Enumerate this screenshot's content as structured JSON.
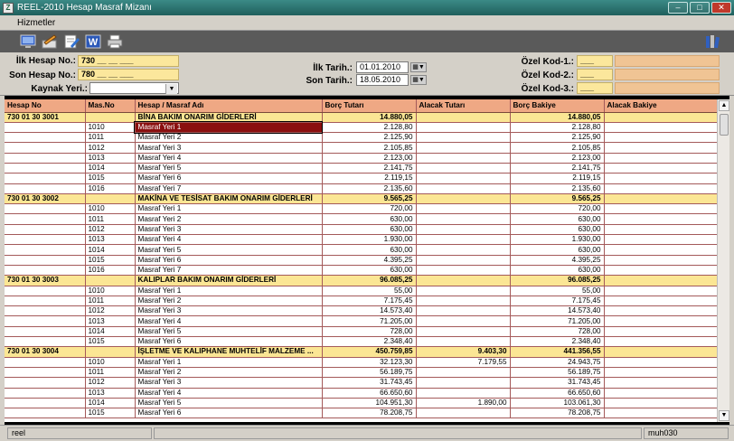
{
  "window": {
    "title": "REEL-2010 Hesap Masraf Mizanı",
    "app_icon": "Z"
  },
  "menu": {
    "items": [
      "Hizmetler"
    ]
  },
  "toolbar": {
    "icons": [
      "monitor-icon",
      "edit-icon",
      "edit-doc-icon",
      "word-icon",
      "printer-icon",
      "books-icon"
    ]
  },
  "form": {
    "ilk_hesap_label": "İlk Hesap No.:",
    "ilk_hesap_value": "730 __ __ ___",
    "son_hesap_label": "Son Hesap No.:",
    "son_hesap_value": "780 __ __ ___",
    "kaynak_label": "Kaynak Yeri.:",
    "kaynak_value": "",
    "ilk_tarih_label": "İlk Tarih.:",
    "ilk_tarih_value": "01.01.2010",
    "son_tarih_label": "Son Tarih.:",
    "son_tarih_value": "18.05.2010",
    "ozel1_label": "Özel Kod-1.:",
    "ozel2_label": "Özel Kod-2.:",
    "ozel3_label": "Özel Kod-3.:",
    "ozel1_value": "___",
    "ozel2_value": "___",
    "ozel3_value": "___"
  },
  "grid": {
    "columns": [
      "Hesap No",
      "Mas.No",
      "Hesap / Masraf Adı",
      "Borç Tutarı",
      "Alacak Tutarı",
      "Borç Bakiye",
      "Alacak Bakiye"
    ],
    "rows": [
      {
        "type": "grp",
        "hesap": "730 01 30 3001",
        "mas": "",
        "ad": "BİNA BAKIM ONARIM GİDERLERİ",
        "borc": "14.880,05",
        "alacak": "",
        "bb": "14.880,05",
        "ab": ""
      },
      {
        "type": "row",
        "hesap": "",
        "mas": "1010",
        "ad": "Masraf Yeri 1",
        "borc": "2.128,80",
        "alacak": "",
        "bb": "2.128,80",
        "ab": "",
        "selected": true
      },
      {
        "type": "row",
        "hesap": "",
        "mas": "1011",
        "ad": "Masraf Yeri 2",
        "borc": "2.125,90",
        "alacak": "",
        "bb": "2.125,90",
        "ab": ""
      },
      {
        "type": "row",
        "hesap": "",
        "mas": "1012",
        "ad": "Masraf Yeri 3",
        "borc": "2.105,85",
        "alacak": "",
        "bb": "2.105,85",
        "ab": ""
      },
      {
        "type": "row",
        "hesap": "",
        "mas": "1013",
        "ad": "Masraf Yeri 4",
        "borc": "2.123,00",
        "alacak": "",
        "bb": "2.123,00",
        "ab": ""
      },
      {
        "type": "row",
        "hesap": "",
        "mas": "1014",
        "ad": "Masraf Yeri 5",
        "borc": "2.141,75",
        "alacak": "",
        "bb": "2.141,75",
        "ab": ""
      },
      {
        "type": "row",
        "hesap": "",
        "mas": "1015",
        "ad": "Masraf Yeri 6",
        "borc": "2.119,15",
        "alacak": "",
        "bb": "2.119,15",
        "ab": ""
      },
      {
        "type": "row",
        "hesap": "",
        "mas": "1016",
        "ad": "Masraf Yeri 7",
        "borc": "2.135,60",
        "alacak": "",
        "bb": "2.135,60",
        "ab": ""
      },
      {
        "type": "grp",
        "hesap": "730 01 30 3002",
        "mas": "",
        "ad": "MAKİNA VE TESİSAT BAKIM ONARIM GİDERLERİ",
        "borc": "9.565,25",
        "alacak": "",
        "bb": "9.565,25",
        "ab": ""
      },
      {
        "type": "row",
        "hesap": "",
        "mas": "1010",
        "ad": "Masraf Yeri 1",
        "borc": "720,00",
        "alacak": "",
        "bb": "720,00",
        "ab": ""
      },
      {
        "type": "row",
        "hesap": "",
        "mas": "1011",
        "ad": "Masraf Yeri 2",
        "borc": "630,00",
        "alacak": "",
        "bb": "630,00",
        "ab": ""
      },
      {
        "type": "row",
        "hesap": "",
        "mas": "1012",
        "ad": "Masraf Yeri 3",
        "borc": "630,00",
        "alacak": "",
        "bb": "630,00",
        "ab": ""
      },
      {
        "type": "row",
        "hesap": "",
        "mas": "1013",
        "ad": "Masraf Yeri 4",
        "borc": "1.930,00",
        "alacak": "",
        "bb": "1.930,00",
        "ab": ""
      },
      {
        "type": "row",
        "hesap": "",
        "mas": "1014",
        "ad": "Masraf Yeri 5",
        "borc": "630,00",
        "alacak": "",
        "bb": "630,00",
        "ab": ""
      },
      {
        "type": "row",
        "hesap": "",
        "mas": "1015",
        "ad": "Masraf Yeri 6",
        "borc": "4.395,25",
        "alacak": "",
        "bb": "4.395,25",
        "ab": ""
      },
      {
        "type": "row",
        "hesap": "",
        "mas": "1016",
        "ad": "Masraf Yeri 7",
        "borc": "630,00",
        "alacak": "",
        "bb": "630,00",
        "ab": ""
      },
      {
        "type": "grp",
        "hesap": "730 01 30 3003",
        "mas": "",
        "ad": "KALIPLAR BAKIM ONARIM GİDERLERİ",
        "borc": "96.085,25",
        "alacak": "",
        "bb": "96.085,25",
        "ab": ""
      },
      {
        "type": "row",
        "hesap": "",
        "mas": "1010",
        "ad": "Masraf Yeri 1",
        "borc": "55,00",
        "alacak": "",
        "bb": "55,00",
        "ab": ""
      },
      {
        "type": "row",
        "hesap": "",
        "mas": "1011",
        "ad": "Masraf Yeri 2",
        "borc": "7.175,45",
        "alacak": "",
        "bb": "7.175,45",
        "ab": ""
      },
      {
        "type": "row",
        "hesap": "",
        "mas": "1012",
        "ad": "Masraf Yeri 3",
        "borc": "14.573,40",
        "alacak": "",
        "bb": "14.573,40",
        "ab": ""
      },
      {
        "type": "row",
        "hesap": "",
        "mas": "1013",
        "ad": "Masraf Yeri 4",
        "borc": "71.205,00",
        "alacak": "",
        "bb": "71.205,00",
        "ab": ""
      },
      {
        "type": "row",
        "hesap": "",
        "mas": "1014",
        "ad": "Masraf Yeri 5",
        "borc": "728,00",
        "alacak": "",
        "bb": "728,00",
        "ab": ""
      },
      {
        "type": "row",
        "hesap": "",
        "mas": "1015",
        "ad": "Masraf Yeri 6",
        "borc": "2.348,40",
        "alacak": "",
        "bb": "2.348,40",
        "ab": ""
      },
      {
        "type": "grp",
        "hesap": "730 01 30 3004",
        "mas": "",
        "ad": "İŞLETME VE KALIPHANE MUHTELİF MALZEME ...",
        "borc": "450.759,85",
        "alacak": "9.403,30",
        "bb": "441.356,55",
        "ab": ""
      },
      {
        "type": "row",
        "hesap": "",
        "mas": "1010",
        "ad": "Masraf Yeri 1",
        "borc": "32.123,30",
        "alacak": "7.179,55",
        "bb": "24.943,75",
        "ab": ""
      },
      {
        "type": "row",
        "hesap": "",
        "mas": "1011",
        "ad": "Masraf Yeri 2",
        "borc": "56.189,75",
        "alacak": "",
        "bb": "56.189,75",
        "ab": ""
      },
      {
        "type": "row",
        "hesap": "",
        "mas": "1012",
        "ad": "Masraf Yeri 3",
        "borc": "31.743,45",
        "alacak": "",
        "bb": "31.743,45",
        "ab": ""
      },
      {
        "type": "row",
        "hesap": "",
        "mas": "1013",
        "ad": "Masraf Yeri 4",
        "borc": "66.650,60",
        "alacak": "",
        "bb": "66.650,60",
        "ab": ""
      },
      {
        "type": "row",
        "hesap": "",
        "mas": "1014",
        "ad": "Masraf Yeri 5",
        "borc": "104.951,30",
        "alacak": "1.890,00",
        "bb": "103.061,30",
        "ab": ""
      },
      {
        "type": "row",
        "hesap": "",
        "mas": "1015",
        "ad": "Masraf Yeri 6",
        "borc": "78.208,75",
        "alacak": "",
        "bb": "78.208,75",
        "ab": ""
      }
    ]
  },
  "status": {
    "left": "reel",
    "right": "muh030"
  }
}
